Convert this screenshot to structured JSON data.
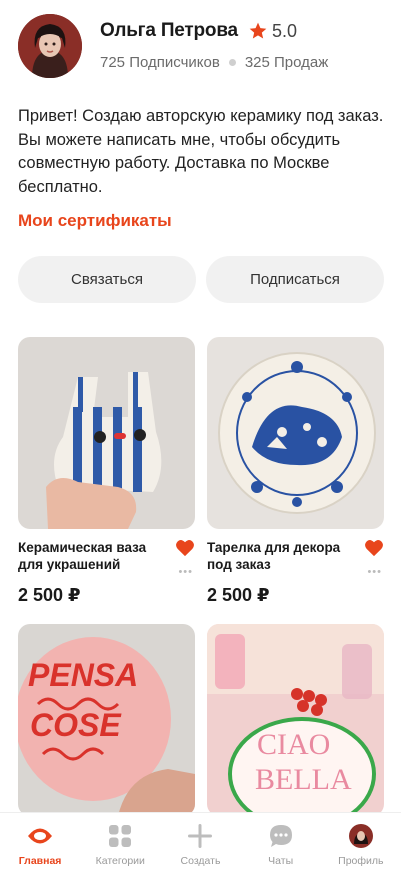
{
  "profile": {
    "name": "Ольга Петрова",
    "rating": "5.0",
    "followers": "725 Подписчиков",
    "sales": "325 Продаж",
    "bio": "Привет! Создаю авторскую керамику под заказ. Вы можете написать мне, чтобы обсудить совместную работу. Доставка по Москве бесплатно.",
    "certificates_link": "Мои сертификаты"
  },
  "actions": {
    "contact_label": "Связаться",
    "subscribe_label": "Подписаться"
  },
  "products": [
    {
      "title": "Керамическая ваза для украшений",
      "price": "2 500 ₽"
    },
    {
      "title": "Тарелка для декора под заказ",
      "price": "2 500 ₽"
    },
    {
      "title": "",
      "price": ""
    },
    {
      "title": "",
      "price": ""
    }
  ],
  "tabbar": {
    "home": "Главная",
    "categories": "Категории",
    "create": "Создать",
    "chats": "Чаты",
    "profile": "Профиль"
  },
  "colors": {
    "accent": "#e8451c",
    "heart": "#e8451c",
    "button_bg": "#f1f1f1"
  }
}
